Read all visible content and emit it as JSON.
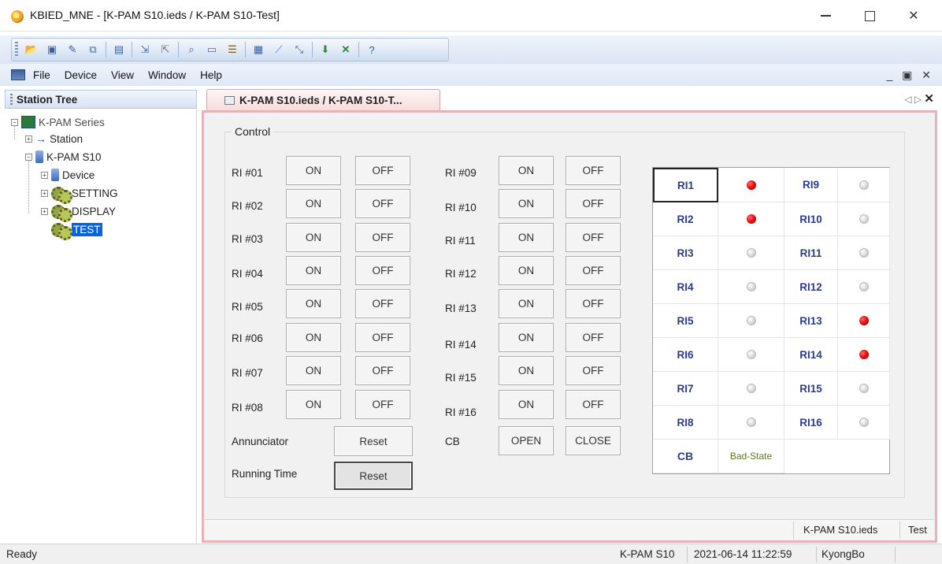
{
  "window": {
    "title": "KBIED_MNE - [K-PAM S10.ieds / K-PAM S10-Test]"
  },
  "menu": {
    "items": [
      "File",
      "Device",
      "View",
      "Window",
      "Help"
    ]
  },
  "toolbar": {
    "icons": [
      "open-icon",
      "save-icon",
      "edit-icon",
      "copy-icon",
      "table-icon",
      "import-icon",
      "export-icon",
      "search-icon",
      "monitor-icon",
      "list-icon",
      "panel-icon",
      "chart-icon",
      "chart-x-icon",
      "download-icon",
      "close-x-icon",
      "help-icon"
    ]
  },
  "tree": {
    "header": "Station Tree",
    "nodes": {
      "series": "K-PAM Series",
      "station": "Station",
      "device_root": "K-PAM S10",
      "device": "Device",
      "setting": "SETTING",
      "display": "DISPLAY",
      "test": "TEST"
    }
  },
  "tab": {
    "label": "K-PAM S10.ieds / K-PAM S10-T..."
  },
  "control": {
    "title": "Control",
    "on_label": "ON",
    "off_label": "OFF",
    "relays_left": [
      "RI #01",
      "RI #02",
      "RI #03",
      "RI #04",
      "RI #05",
      "RI #06",
      "RI #07",
      "RI #08"
    ],
    "relays_right": [
      "RI #09",
      "RI #10",
      "RI #11",
      "RI #12",
      "RI #13",
      "RI #14",
      "RI #15",
      "RI #16"
    ],
    "annunciator_label": "Annunciator",
    "annunciator_reset": "Reset",
    "running_time_label": "Running Time",
    "running_time_reset": "Reset",
    "cb_label": "CB",
    "cb_open": "OPEN",
    "cb_close": "CLOSE"
  },
  "status_grid": {
    "left": [
      {
        "name": "RI1",
        "state": "on"
      },
      {
        "name": "RI2",
        "state": "on"
      },
      {
        "name": "RI3",
        "state": "off"
      },
      {
        "name": "RI4",
        "state": "off"
      },
      {
        "name": "RI5",
        "state": "off"
      },
      {
        "name": "RI6",
        "state": "off"
      },
      {
        "name": "RI7",
        "state": "off"
      },
      {
        "name": "RI8",
        "state": "off"
      }
    ],
    "right": [
      {
        "name": "RI9",
        "state": "off"
      },
      {
        "name": "RI10",
        "state": "off"
      },
      {
        "name": "RI11",
        "state": "off"
      },
      {
        "name": "RI12",
        "state": "off"
      },
      {
        "name": "RI13",
        "state": "on"
      },
      {
        "name": "RI14",
        "state": "on"
      },
      {
        "name": "RI15",
        "state": "off"
      },
      {
        "name": "RI16",
        "state": "off"
      }
    ],
    "cb_name": "CB",
    "cb_state": "Bad-State"
  },
  "doc_status": {
    "file": "K-PAM S10.ieds",
    "mode": "Test"
  },
  "statusbar": {
    "ready": "Ready",
    "device": "K-PAM S10",
    "datetime": "2021-06-14 11:22:59",
    "user": "KyongBo"
  },
  "colors": {
    "led_on": "#e60000",
    "led_off": "#d6d6d6",
    "tab_border": "#e7b3b6",
    "selection": "#0a63d9"
  }
}
